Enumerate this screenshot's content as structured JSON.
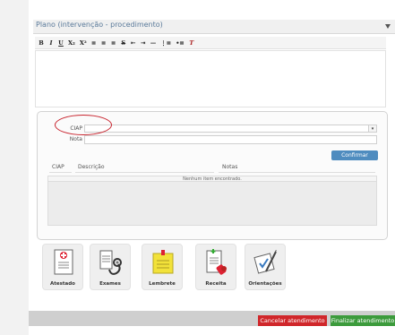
{
  "section": {
    "title": "Plano (intervenção - procedimento)"
  },
  "toolbar": {
    "buttons": [
      {
        "label": "B",
        "icon": "bold-icon"
      },
      {
        "label": "I",
        "icon": "italic-icon"
      },
      {
        "label": "U",
        "icon": "underline-icon"
      },
      {
        "label": "X₂",
        "icon": "subscript-icon"
      },
      {
        "label": "X²",
        "icon": "superscript-icon"
      },
      {
        "label": "≡",
        "icon": "align-left-icon"
      },
      {
        "label": "≡",
        "icon": "align-center-icon"
      },
      {
        "label": "≡",
        "icon": "align-right-icon"
      },
      {
        "label": "S",
        "icon": "strikethrough-icon"
      },
      {
        "label": "⇤",
        "icon": "outdent-icon"
      },
      {
        "label": "⇥",
        "icon": "indent-icon"
      },
      {
        "label": "—",
        "icon": "horizontal-rule-icon"
      },
      {
        "label": "⋮≡",
        "icon": "ordered-list-icon"
      },
      {
        "label": "•≡",
        "icon": "unordered-list-icon"
      },
      {
        "label": "T",
        "icon": "clear-format-icon"
      }
    ]
  },
  "form": {
    "ciap_label": "CIAP",
    "nota_label": "Nota",
    "confirm_label": "Confirmar"
  },
  "table": {
    "headers": [
      "CIAP",
      "Descrição",
      "Notas"
    ],
    "empty_text": "Nenhum item encontrado."
  },
  "actions": [
    {
      "label": "Atestado",
      "icon": "certificate-icon"
    },
    {
      "label": "Exames",
      "icon": "stethoscope-icon"
    },
    {
      "label": "Lembrete",
      "icon": "sticky-note-icon"
    },
    {
      "label": "Receita",
      "icon": "prescription-icon"
    },
    {
      "label": "Orientações",
      "icon": "guidance-icon"
    }
  ],
  "footer": {
    "cancel_label": "Cancelar atendimento",
    "finish_label": "Finalizar atendimento"
  },
  "colors": {
    "cancel": "#d0262a",
    "finish": "#3c9b3c",
    "confirm": "#4f8cbf",
    "highlight_circle": "#c8242e"
  }
}
